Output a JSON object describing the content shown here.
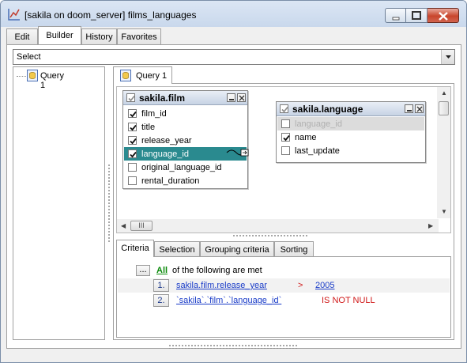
{
  "window": {
    "title": "[sakila on doom_server] films_languages"
  },
  "main_tabs": [
    {
      "label": "Edit"
    },
    {
      "label": "Builder"
    },
    {
      "label": "History"
    },
    {
      "label": "Favorites"
    }
  ],
  "select_combo": {
    "value": "Select"
  },
  "tree": {
    "query_label": "Query 1"
  },
  "query_tab": {
    "label": "Query 1"
  },
  "tables": {
    "film": {
      "title": "sakila.film",
      "fields": [
        {
          "name": "film_id",
          "checked": true
        },
        {
          "name": "title",
          "checked": true
        },
        {
          "name": "release_year",
          "checked": true
        },
        {
          "name": "language_id",
          "checked": true
        },
        {
          "name": "original_language_id",
          "checked": false
        },
        {
          "name": "rental_duration",
          "checked": false
        }
      ]
    },
    "language": {
      "title": "sakila.language",
      "fields": [
        {
          "name": "language_id",
          "checked": false
        },
        {
          "name": "name",
          "checked": true
        },
        {
          "name": "last_update",
          "checked": false
        }
      ]
    }
  },
  "scroll": {
    "hthumb_glyph": "III"
  },
  "criteria_tabs": [
    {
      "label": "Criteria"
    },
    {
      "label": "Selection"
    },
    {
      "label": "Grouping criteria"
    },
    {
      "label": "Sorting"
    }
  ],
  "criteria": {
    "header": {
      "button": "...",
      "all": "All",
      "text": "of the following are met"
    },
    "rows": [
      {
        "num": "1.",
        "field": "sakila.film.release_year",
        "op": ">",
        "value": "2005"
      },
      {
        "num": "2.",
        "field": "`sakila`.`film`.`language_id`",
        "op": "IS NOT NULL",
        "value": ""
      }
    ]
  },
  "colors": {
    "selected_row": "#2a8a8f",
    "link": "#1a3cc8",
    "all_link": "#0a8a0a",
    "operator": "#d01818"
  }
}
